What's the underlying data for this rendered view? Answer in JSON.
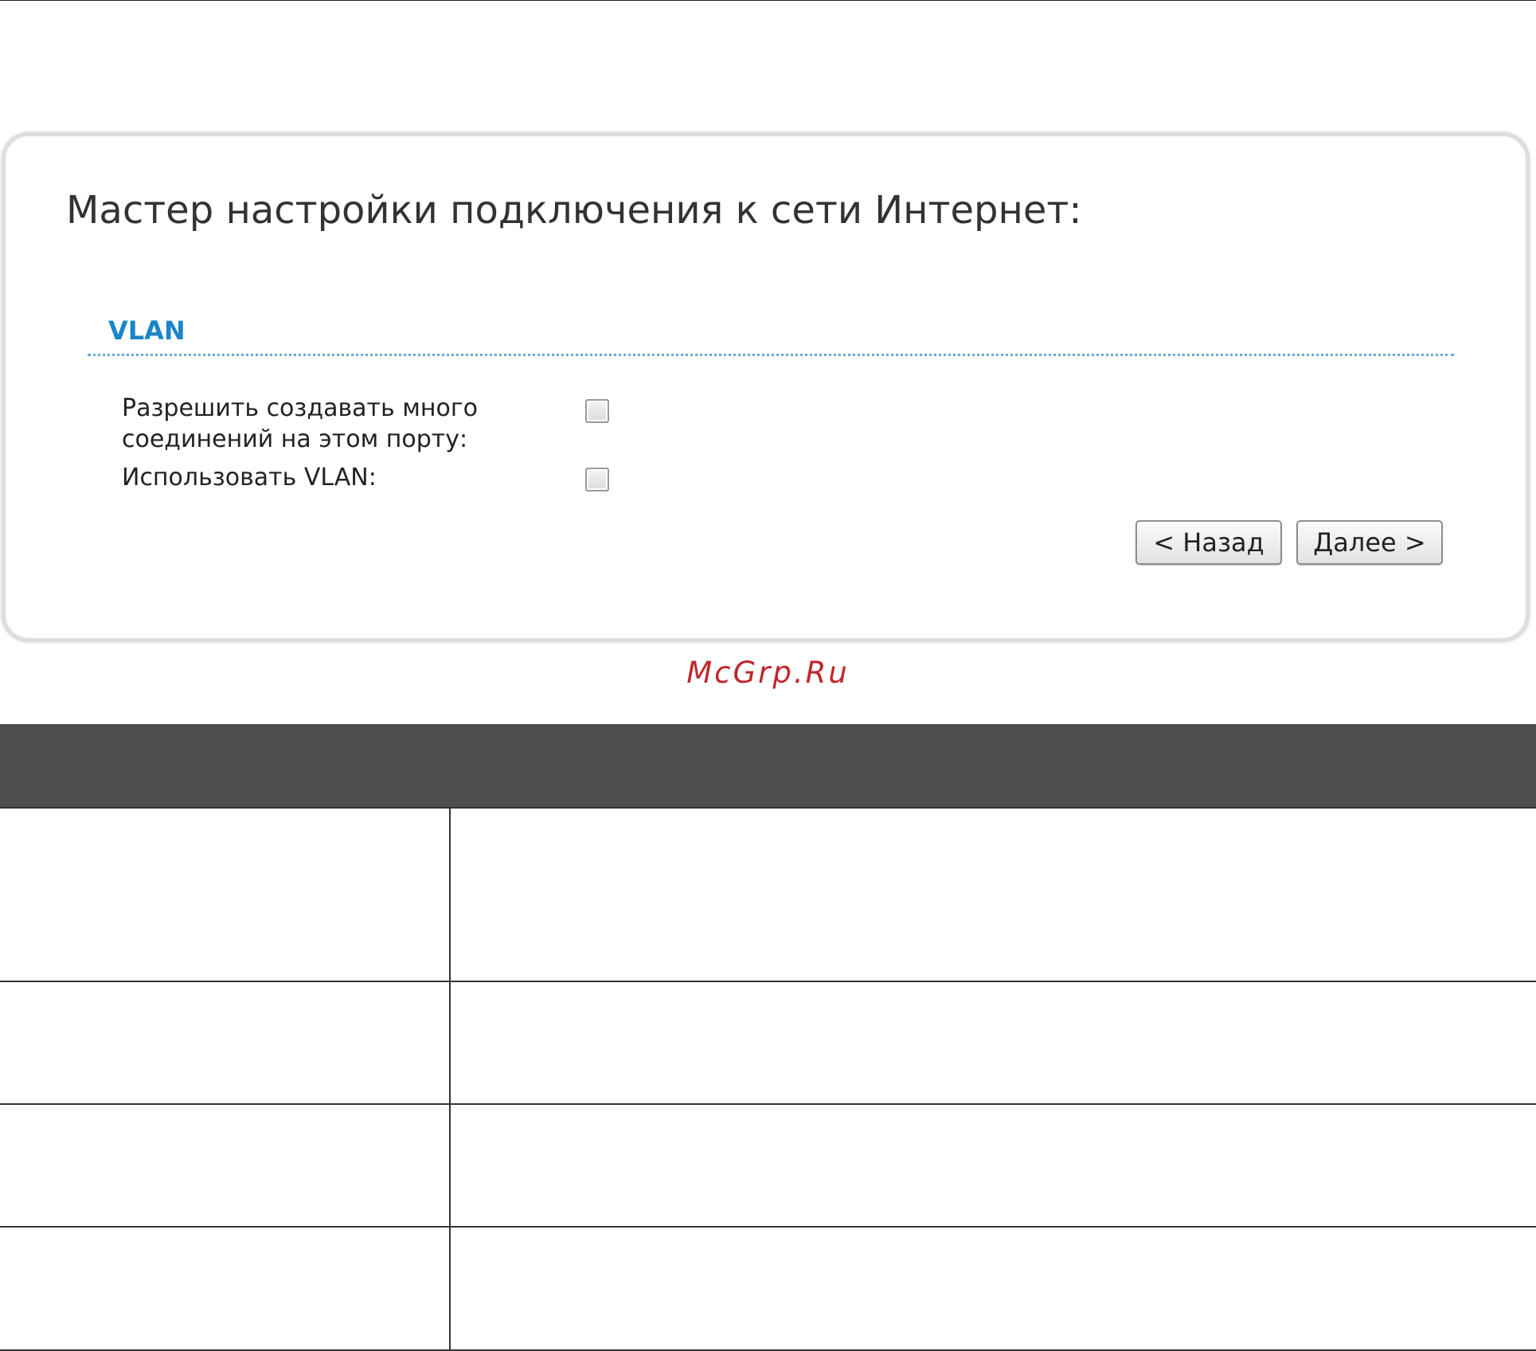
{
  "wizard": {
    "title": "Мастер настройки подключения к сети Интернет:",
    "section_title": "VLAN",
    "fields": {
      "multi_connections": {
        "label_line1": "Разрешить создавать много",
        "label_line2": "соединений на этом порту:",
        "checked": false
      },
      "use_vlan": {
        "label": "Использовать VLAN:",
        "checked": false
      }
    },
    "buttons": {
      "back_label": "< Назад",
      "next_label": "Далее >"
    }
  },
  "watermark": {
    "text": "McGrp.Ru"
  },
  "table": {
    "header": {
      "parameter": "",
      "description": ""
    },
    "rows": [
      {
        "parameter": "",
        "description": ""
      },
      {
        "parameter": "",
        "description": ""
      },
      {
        "parameter": "",
        "description": ""
      },
      {
        "parameter": "",
        "description": ""
      }
    ]
  },
  "colors": {
    "section_title": "#1a86c8",
    "divider": "#6aa7d2",
    "watermark": "#c0262d",
    "table_header_bg": "#4d4d4d"
  }
}
